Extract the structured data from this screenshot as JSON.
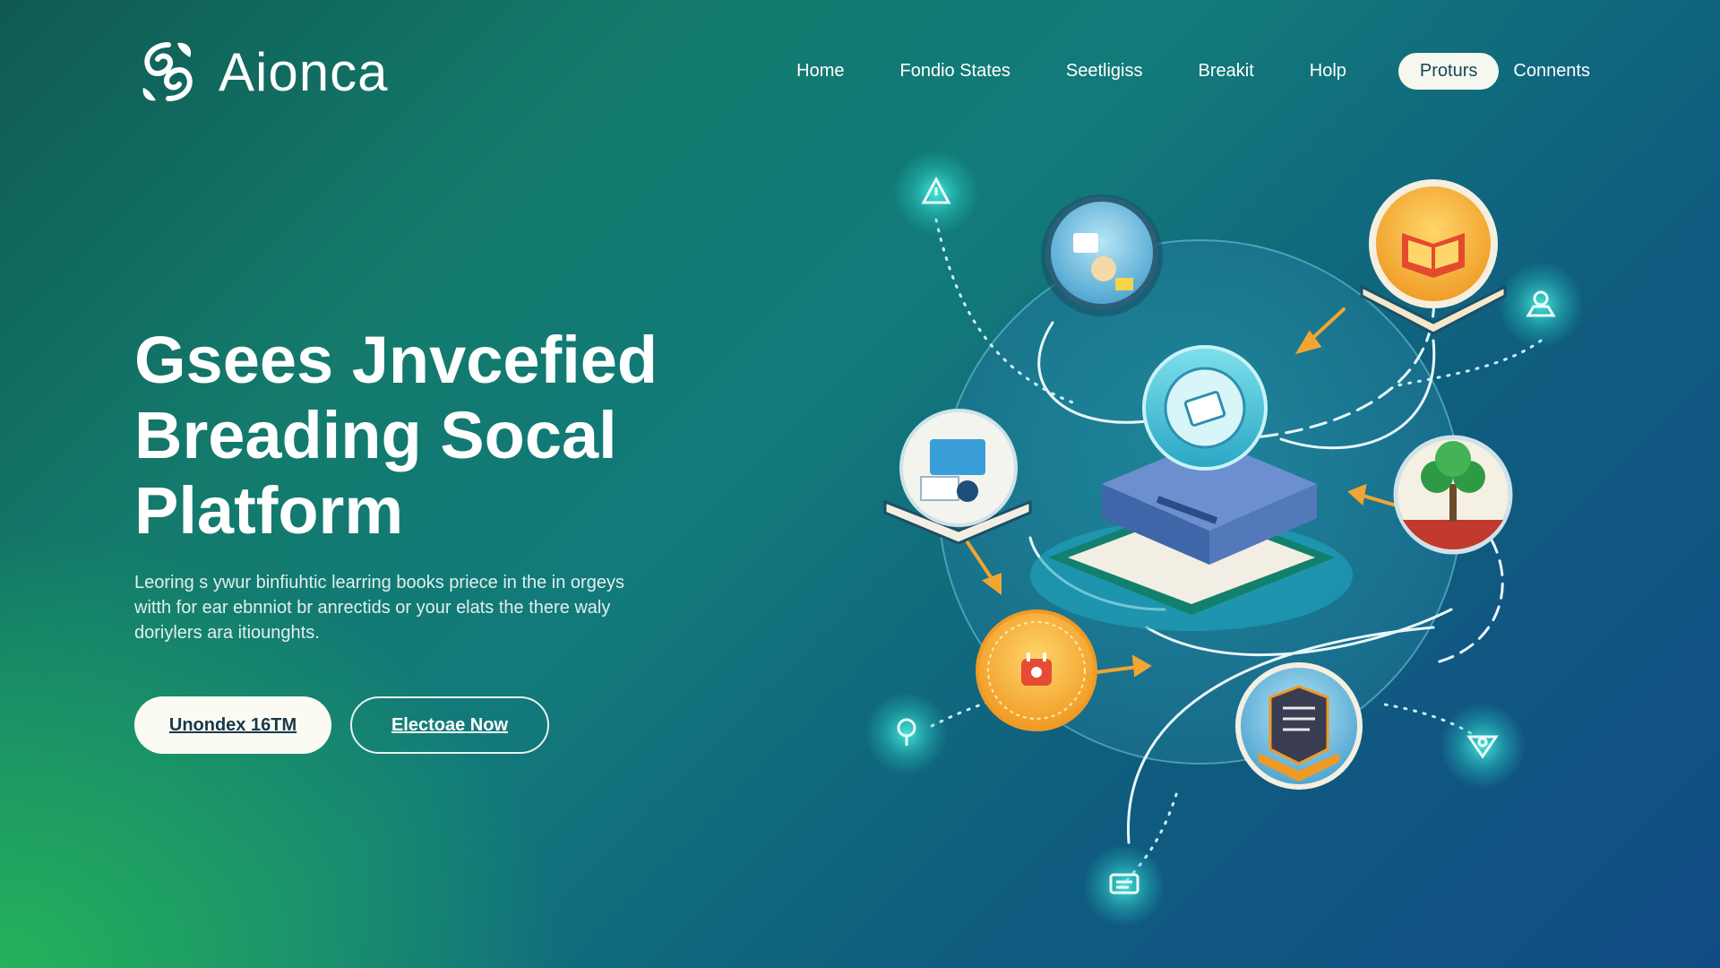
{
  "header": {
    "brand": "Aionca",
    "logo_icon": "swirl-logo-icon",
    "nav": [
      "Home",
      "Fondio States",
      "Seetligiss",
      "Breakit",
      "Holp"
    ],
    "nav_pill": "Proturs",
    "nav_last": "Connents"
  },
  "hero": {
    "headline": [
      "Gsees Jnvcefied",
      "Breading Socal",
      "Platform"
    ],
    "sub": "Leoring s ywur binfiuhtic learring books priece in the in orgeys witth for ear ebnniot br anrectids or your elats the there waly doriylers ara itiounghts.",
    "cta_primary": "Unondex 16TM",
    "cta_secondary": "Electoae Now"
  },
  "illustration": {
    "icons": [
      "warning-icon",
      "user-badge-icon",
      "lightbulb-icon",
      "shield-check-icon",
      "chat-icon",
      "science-badge-icon",
      "open-book-icon",
      "document-card-icon",
      "growth-tree-icon",
      "robot-badge-icon",
      "reading-list-icon",
      "server-platform-icon"
    ]
  },
  "colors": {
    "bg_green": "#25b25a",
    "bg_teal": "#127a7a",
    "bg_blue": "#124c86",
    "pill_bg": "#f6f7ef",
    "accent_orange": "#f0a630",
    "node_blue": "#5bb8de"
  }
}
